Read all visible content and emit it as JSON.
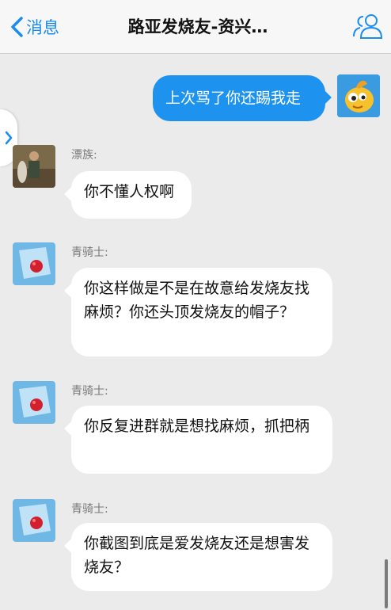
{
  "navbar": {
    "back_label": "消息",
    "title": "路亚发烧友-资兴…"
  },
  "messages": [
    {
      "id": "m1",
      "direction": "out",
      "text": "上次骂了你还踢我走"
    },
    {
      "id": "m2",
      "direction": "in",
      "sender": "漂族:",
      "text": "你不懂人权啊"
    },
    {
      "id": "m3",
      "direction": "in",
      "sender": "青骑士:",
      "text": "你这样做是不是在故意给发烧友找麻烦？你还头顶发烧友的帽子？"
    },
    {
      "id": "m4",
      "direction": "in",
      "sender": "青骑士:",
      "text": "你反复进群就是想找麻烦，抓把柄"
    },
    {
      "id": "m5",
      "direction": "in",
      "sender": "青骑士:",
      "text": "你截图到底是爱发烧友还是想害发烧友？"
    }
  ],
  "colors": {
    "accent": "#1a8cf0",
    "outgoing_bubble": "#1d93ef",
    "background": "#ebebeb"
  },
  "icons": {
    "back": "chevron-left-icon",
    "members": "people-icon",
    "drawer": "chevron-right-icon"
  }
}
